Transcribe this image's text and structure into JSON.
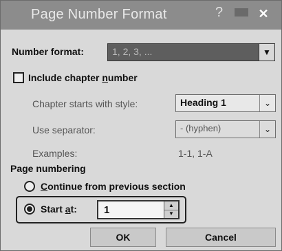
{
  "window": {
    "title": "Page Number Format",
    "help_glyph": "?",
    "close_glyph": "✕"
  },
  "number_format": {
    "label": "Number format:",
    "value": "1, 2, 3, ..."
  },
  "include_chapter": {
    "label_pre": "Include chapter ",
    "label_acc": "n",
    "label_post": "umber",
    "checked": false
  },
  "chapter_style": {
    "label": "Chapter starts with style:",
    "value": "Heading 1"
  },
  "separator": {
    "label": "Use separator:",
    "value": "-  (hyphen)"
  },
  "examples": {
    "label": "Examples:",
    "value": "1-1, 1-A"
  },
  "page_numbering": {
    "group_label": "Page numbering",
    "continue_pre": "",
    "continue_acc": "C",
    "continue_post": "ontinue from previous section",
    "start_pre": "Start ",
    "start_acc": "a",
    "start_post": "t:",
    "start_value": "1",
    "selected": "start_at"
  },
  "buttons": {
    "ok": "OK",
    "cancel": "Cancel"
  },
  "icons": {
    "dropdown": "chevron-down-icon",
    "spin_up": "triangle-up-icon",
    "spin_down": "triangle-down-icon",
    "close": "close-icon",
    "help": "help-icon"
  }
}
